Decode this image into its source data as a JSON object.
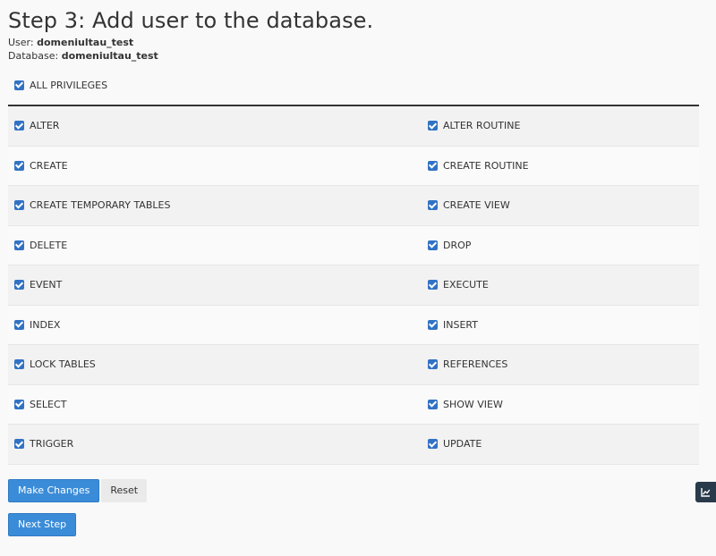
{
  "page": {
    "title": "Step 3: Add user to the database.",
    "user_label": "User:",
    "user_value": "domeniultau_test",
    "db_label": "Database:",
    "db_value": "domeniultau_test"
  },
  "all_privileges": {
    "label": "ALL PRIVILEGES",
    "checked": true
  },
  "privileges": [
    {
      "left": "ALTER",
      "right": "ALTER ROUTINE"
    },
    {
      "left": "CREATE",
      "right": "CREATE ROUTINE"
    },
    {
      "left": "CREATE TEMPORARY TABLES",
      "right": "CREATE VIEW"
    },
    {
      "left": "DELETE",
      "right": "DROP"
    },
    {
      "left": "EVENT",
      "right": "EXECUTE"
    },
    {
      "left": "INDEX",
      "right": "INSERT"
    },
    {
      "left": "LOCK TABLES",
      "right": "REFERENCES"
    },
    {
      "left": "SELECT",
      "right": "SHOW VIEW"
    },
    {
      "left": "TRIGGER",
      "right": "UPDATE"
    }
  ],
  "buttons": {
    "make_changes": "Make Changes",
    "reset": "Reset",
    "next_step": "Next Step"
  },
  "side_tab": {
    "icon": "chart-icon"
  },
  "colors": {
    "checkbox": "#3172c4",
    "primary_button": "#3b8cd8",
    "side_tab": "#293a4a"
  }
}
